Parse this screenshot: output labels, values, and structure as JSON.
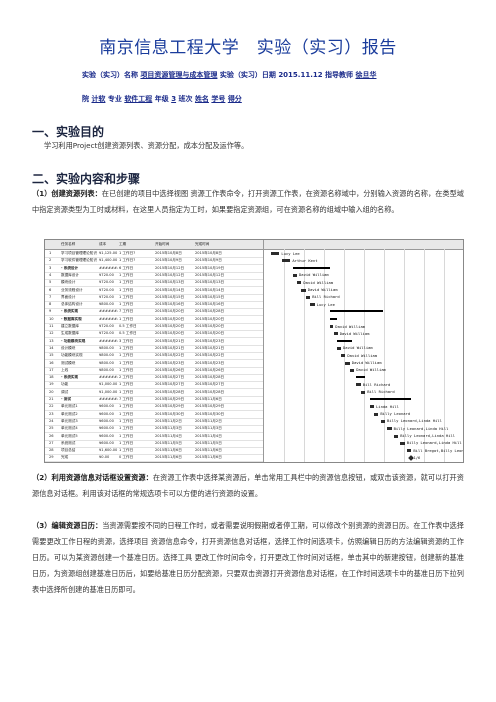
{
  "title": "南京信息工程大学　实验（实习）报告",
  "meta1": {
    "course_label": "实验（实习）名称",
    "course": "项目资源管理与成本管理",
    "date_label": "实验（实习）日期",
    "date": "2015.11.12",
    "teacher_label": "指导教师",
    "teacher": "徐旦华"
  },
  "meta2": {
    "dept_label": "院",
    "dept": "计软",
    "major_label": "专业",
    "major": "软件工程",
    "grade_label": "年级",
    "grade": "3",
    "class_label": "班次",
    "name_label": "姓名",
    "id_label": "学号",
    "score_label": "得分"
  },
  "section1": {
    "heading": "一、实验目的",
    "text": "学习利用Project创建资源列表、资源分配，成本分配及运作等。"
  },
  "section2": {
    "heading": "二、实验内容和步骤",
    "step1_title": "（1）创建资源列表：",
    "step1_text": "在已创建的项目中选择视图 资源工作表命令，打开资源工作表，在资源名称域中，分别输入资源的名称，在类型域中指定资源类型为工时或材料，在这里人员指定为工时，如果要指定资源组，可在资源名称的组域中输入组的名称。",
    "step2_title": "（2）利用资源信息对话框设置资源：",
    "step2_text": "在资源工作表中选择某资源后，单击常用工具栏中的资源信息按钮，或双击该资源，就可以打开资源信息对话框。利用该对话框的常规选项卡可以方便的进行资源的设置。",
    "step3_title": "（3）编辑资源日历：",
    "step3_text": "当资源需要按不同的日程工作时，或者需要说明假期或者停工期，可以修改个别资源的资源日历。在工作表中选择需要更改工作日程的资源，选择项目 资源信息命令，打开资源信息对话框，选择工作时间选项卡，仿照编辑日历的方法编辑资源的工作日历。可以为某资源创建一个基准日历。选择工具 更改工作时间命令，打开更改工作时间对话框，单击其中的新建按钮，创建新的基准日历，为资源组创建基准日历后，如要给基准日历分配资源，只要双击资源打开资源信息对话框，在工作时间选项卡中的基准日历下拉列表中选择所创建的基准日历即可。"
  },
  "gantt": {
    "columns": [
      "任务名称",
      "成本",
      "工期",
      "开始时间",
      "完成时间"
    ],
    "rows": [
      {
        "id": "1",
        "name": "学习项目管理理论知识",
        "cost": "¥1,125.00",
        "dur": "1 工作日?",
        "start": "2015年10月8日",
        "end": "2015年10月8日"
      },
      {
        "id": "2",
        "name": "学习软件管理理论知识",
        "cost": "¥1,400.00",
        "dur": "1 工作日?",
        "start": "2015年10月9日",
        "end": "2015年10月9日"
      },
      {
        "id": "3",
        "name": "- 系统设计",
        "cost": "########",
        "dur": "6 工作日",
        "start": "2015年10月12日",
        "end": "2015年10月19日"
      },
      {
        "id": "4",
        "name": "数据库设计",
        "cost": "¥720.00",
        "dur": "1 工作日",
        "start": "2015年10月12日",
        "end": "2015年10月12日"
      },
      {
        "id": "5",
        "name": "模块设计",
        "cost": "¥720.00",
        "dur": "1 工作日",
        "start": "2015年10月13日",
        "end": "2015年10月13日"
      },
      {
        "id": "6",
        "name": "业务流程设计",
        "cost": "¥720.00",
        "dur": "1 工作日",
        "start": "2015年10月14日",
        "end": "2015年10月14日"
      },
      {
        "id": "7",
        "name": "界面设计",
        "cost": "¥720.00",
        "dur": "1 工作日",
        "start": "2015年10月15日",
        "end": "2015年10月15日"
      },
      {
        "id": "8",
        "name": "总体结构设计",
        "cost": "¥800.00",
        "dur": "1 工作日",
        "start": "2015年10月16日",
        "end": "2015年10月16日"
      },
      {
        "id": "9",
        "name": "- 系统实现",
        "cost": "########",
        "dur": "7 工作日",
        "start": "2015年10月20日",
        "end": "2015年10月28日"
      },
      {
        "id": "10",
        "name": "- 数据库实现",
        "cost": "########",
        "dur": "1 工作日",
        "start": "2015年10月20日",
        "end": "2015年10月20日"
      },
      {
        "id": "11",
        "name": "建立数据库",
        "cost": "¥720.00",
        "dur": "0.5 工作日",
        "start": "2015年10月20日",
        "end": "2015年10月20日"
      },
      {
        "id": "12",
        "name": "生成数据库",
        "cost": "¥720.00",
        "dur": "0.5 工作日",
        "start": "2015年10月20日",
        "end": "2015年10月20日"
      },
      {
        "id": "13",
        "name": "- 功能模块实现",
        "cost": "########",
        "dur": "3 工作日",
        "start": "2015年10月21日",
        "end": "2015年10月23日"
      },
      {
        "id": "14",
        "name": "设计模块",
        "cost": "¥800.00",
        "dur": "1 工作日",
        "start": "2015年10月21日",
        "end": "2015年10月21日"
      },
      {
        "id": "15",
        "name": "功能模块实现",
        "cost": "¥800.00",
        "dur": "1 工作日",
        "start": "2015年10月22日",
        "end": "2015年10月22日"
      },
      {
        "id": "16",
        "name": "测试模块",
        "cost": "¥800.00",
        "dur": "1 工作日",
        "start": "2015年10月23日",
        "end": "2015年10月23日"
      },
      {
        "id": "17",
        "name": "上线",
        "cost": "¥800.00",
        "dur": "1 工作日",
        "start": "2015年10月26日",
        "end": "2015年10月26日"
      },
      {
        "id": "18",
        "name": "- 系统实现",
        "cost": "########",
        "dur": "2 工作日",
        "start": "2015年10月27日",
        "end": "2015年10月28日"
      },
      {
        "id": "19",
        "name": "功能",
        "cost": "¥1,000.00",
        "dur": "1 工作日",
        "start": "2015年10月27日",
        "end": "2015年10月27日"
      },
      {
        "id": "20",
        "name": "调试",
        "cost": "¥1,000.00",
        "dur": "1 工作日",
        "start": "2015年10月28日",
        "end": "2015年10月28日"
      },
      {
        "id": "21",
        "name": "- 测试",
        "cost": "########",
        "dur": "7 工作日",
        "start": "2015年10月29日",
        "end": "2015年11月6日"
      },
      {
        "id": "22",
        "name": "单元测试1",
        "cost": "¥600.00",
        "dur": "1 工作日",
        "start": "2015年10月29日",
        "end": "2015年10月29日"
      },
      {
        "id": "23",
        "name": "单元测试2",
        "cost": "¥600.00",
        "dur": "1 工作日",
        "start": "2015年10月30日",
        "end": "2015年10月30日"
      },
      {
        "id": "24",
        "name": "单元测试3",
        "cost": "¥600.00",
        "dur": "1 工作日",
        "start": "2015年11月2日",
        "end": "2015年11月2日"
      },
      {
        "id": "25",
        "name": "单元测试4",
        "cost": "¥600.00",
        "dur": "1 工作日",
        "start": "2015年11月3日",
        "end": "2015年11月3日"
      },
      {
        "id": "26",
        "name": "单元测试5",
        "cost": "¥600.00",
        "dur": "1 工作日",
        "start": "2015年11月4日",
        "end": "2015年11月4日"
      },
      {
        "id": "27",
        "name": "系统测试",
        "cost": "¥600.00",
        "dur": "1 工作日",
        "start": "2015年11月5日",
        "end": "2015年11月5日"
      },
      {
        "id": "28",
        "name": "项目总结",
        "cost": "¥1,600.00",
        "dur": "1 工作日",
        "start": "2015年11月6日",
        "end": "2015年11月6日"
      },
      {
        "id": "29",
        "name": "完成",
        "cost": "¥0.00",
        "dur": "0 工作日",
        "start": "2015年11月6日",
        "end": "2015年11月6日"
      }
    ],
    "bars": [
      {
        "label": "Lucy Lee"
      },
      {
        "label": "Arthur Kent"
      },
      {
        "label": ""
      },
      {
        "label": "David William"
      },
      {
        "label": "David William"
      },
      {
        "label": "David William"
      },
      {
        "label": "Bill Richard"
      },
      {
        "label": "Lucy Lee"
      },
      {
        "label": ""
      },
      {
        "label": ""
      },
      {
        "label": "David William"
      },
      {
        "label": "David William"
      },
      {
        "label": ""
      },
      {
        "label": "David William"
      },
      {
        "label": "David William"
      },
      {
        "label": "David William"
      },
      {
        "label": "David William"
      },
      {
        "label": ""
      },
      {
        "label": "Bill Richard"
      },
      {
        "label": "Bill Richard"
      },
      {
        "label": ""
      },
      {
        "label": "Linda Hill"
      },
      {
        "label": "Billy Leonard"
      },
      {
        "label": "Billy Leonard,Linda Hill"
      },
      {
        "label": "Billy Leonard,Linda Hill"
      },
      {
        "label": "Billy Leonard,Linda Hill"
      },
      {
        "label": "Billy Leonard,Linda Hill"
      },
      {
        "label": "Bill Bregot,Billy Leonard,Linda Hill"
      },
      {
        "label": "11/6"
      }
    ]
  }
}
